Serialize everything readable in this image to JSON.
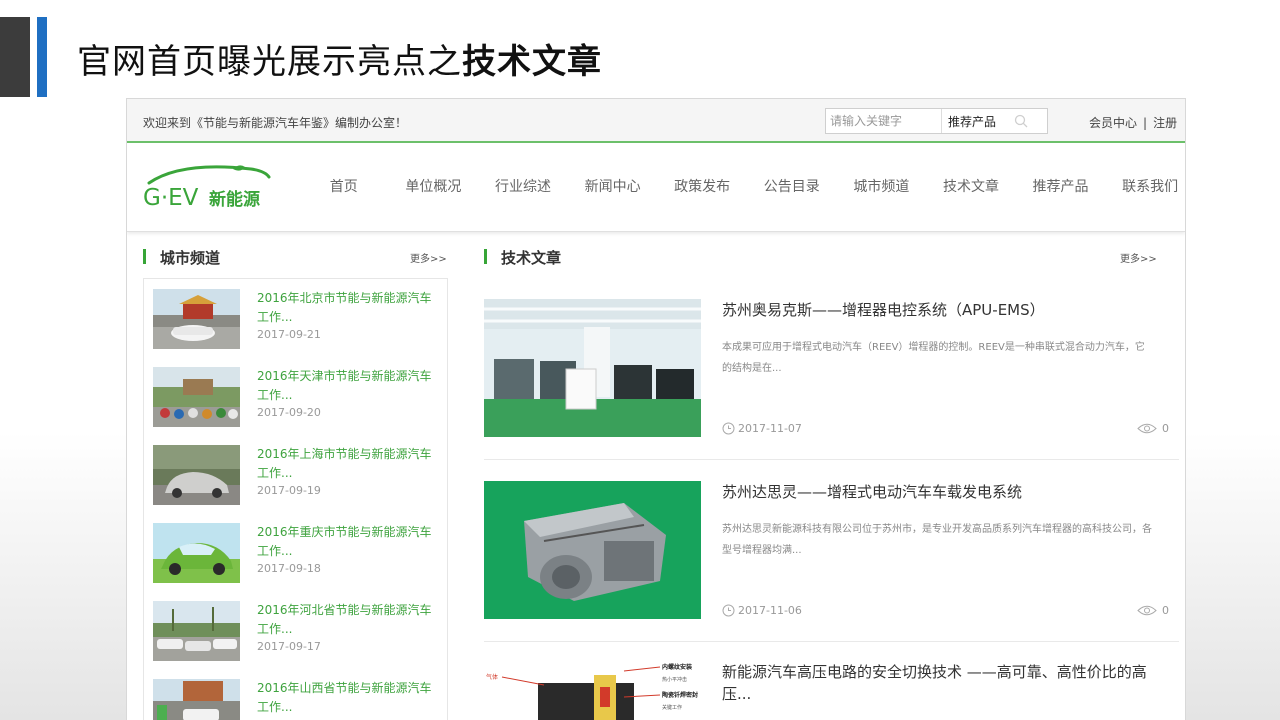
{
  "slide": {
    "title_main": "官网首页曝光展示亮点之",
    "title_bold": "技术文章"
  },
  "topbar": {
    "welcome": "欢迎来到《节能与新能源汽车年鉴》编制办公室！",
    "search_placeholder": "请输入关键字",
    "search_type": "推荐产品",
    "member_center": "会员中心",
    "separator": "|",
    "register": "注册"
  },
  "logo": {
    "brand": "G·EV",
    "brand_cn": "新能源",
    "color": "#3aa53a"
  },
  "nav": {
    "items": [
      "首页",
      "单位概况",
      "行业综述",
      "新闻中心",
      "政策发布",
      "公告目录",
      "城市频道",
      "技术文章",
      "推荐产品",
      "联系我们"
    ]
  },
  "city_channel": {
    "title": "城市频道",
    "more": "更多>>",
    "items": [
      {
        "title": "2016年北京市节能与新能源汽车工作...",
        "date": "2017-09-21"
      },
      {
        "title": "2016年天津市节能与新能源汽车工作...",
        "date": "2017-09-20"
      },
      {
        "title": "2016年上海市节能与新能源汽车工作...",
        "date": "2017-09-19"
      },
      {
        "title": "2016年重庆市节能与新能源汽车工作...",
        "date": "2017-09-18"
      },
      {
        "title": "2016年河北省节能与新能源汽车工作...",
        "date": "2017-09-17"
      },
      {
        "title": "2016年山西省节能与新能源汽车工作...",
        "date": ""
      }
    ]
  },
  "tech_articles": {
    "title": "技术文章",
    "more": "更多>>",
    "items": [
      {
        "title": "苏州奥易克斯——增程器电控系统（APU-EMS）",
        "desc": "本成果可应用于增程式电动汽车（REEV）增程器的控制。REEV是一种串联式混合动力汽车，它的结构是在...",
        "date": "2017-11-07",
        "views": "0"
      },
      {
        "title": "苏州达思灵——增程式电动汽车车载发电系统",
        "desc": "苏州达思灵新能源科技有限公司位于苏州市，是专业开发高品质系列汽车增程器的高科技公司，各型号增程器均满...",
        "date": "2017-11-06",
        "views": "0"
      },
      {
        "title": "新能源汽车高压电路的安全切换技术 ——高可靠、高性价比的高压...",
        "desc": "",
        "date": "",
        "views": ""
      }
    ]
  },
  "diagram_labels": {
    "l1": "内螺纹安装",
    "l2": "陶瓷钎焊密封",
    "l3": "气体",
    "l4": "热小平冲击",
    "l5": "关键工作"
  },
  "colors": {
    "accent_green": "#37a537",
    "link_green": "#3fa33f",
    "slide_blue": "#1f6fc2",
    "slide_dark": "#3c3c3c"
  }
}
